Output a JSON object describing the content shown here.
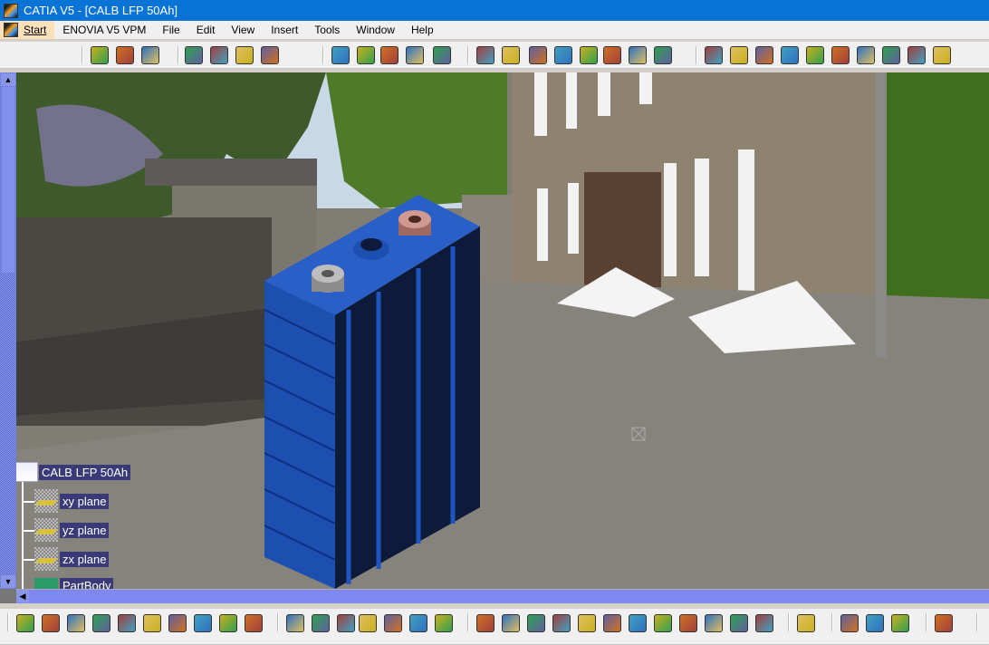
{
  "window": {
    "title": "CATIA V5 - [CALB LFP 50Ah]"
  },
  "menubar": {
    "items": [
      "Start",
      "ENOVIA V5 VPM",
      "File",
      "Edit",
      "View",
      "Insert",
      "Tools",
      "Window",
      "Help"
    ]
  },
  "tree": {
    "root": "CALB LFP 50Ah",
    "children": [
      "xy plane",
      "yz plane",
      "zx plane",
      "PartBody"
    ]
  },
  "toolbar_top": {
    "icons": [
      "point-icon",
      "line-icon",
      "plane-icon",
      "sketch-icon",
      "positioned-sketch-icon",
      "sketch-analysis-icon",
      "sketch-edit-icon",
      "text-with-leader-icon",
      "flag-note-icon",
      "annotation-plane-icon",
      "material-icon",
      "measure-icon",
      "pad-icon",
      "pocket-icon",
      "shaft-icon",
      "groove-icon",
      "hole-icon",
      "rib-icon",
      "slot-icon",
      "stiffener-icon",
      "fillet-icon",
      "chamfer-icon",
      "draft-icon",
      "shell-icon",
      "thickness-icon",
      "thread-icon",
      "remove-face-icon",
      "replace-face-icon",
      "split-icon",
      "sew-icon"
    ]
  },
  "toolbar_bottom": {
    "icons": [
      "new-icon",
      "open-icon",
      "save-icon",
      "print-icon",
      "cut-icon",
      "copy-icon",
      "paste-icon",
      "undo-icon",
      "redo-icon",
      "whats-this-icon",
      "formula-icon",
      "knowledge-icon",
      "catalog-icon",
      "table-icon",
      "tree-icon",
      "lock-icon",
      "parameters-icon",
      "fly-mode-icon",
      "fit-all-icon",
      "pan-icon",
      "rotate-icon",
      "zoom-in-icon",
      "zoom-out-icon",
      "normal-view-icon",
      "multi-view-icon",
      "iso-view-icon",
      "shading-icon",
      "hide-show-icon",
      "swap-space-icon",
      "update-icon",
      "measure-between-icon",
      "measure-item-icon",
      "apply-material-icon",
      "capture-icon"
    ]
  },
  "colors": {
    "titlebar": "#0a73d6",
    "tree_label_bg": "#3a3a78",
    "battery": "#1c4fb0"
  }
}
